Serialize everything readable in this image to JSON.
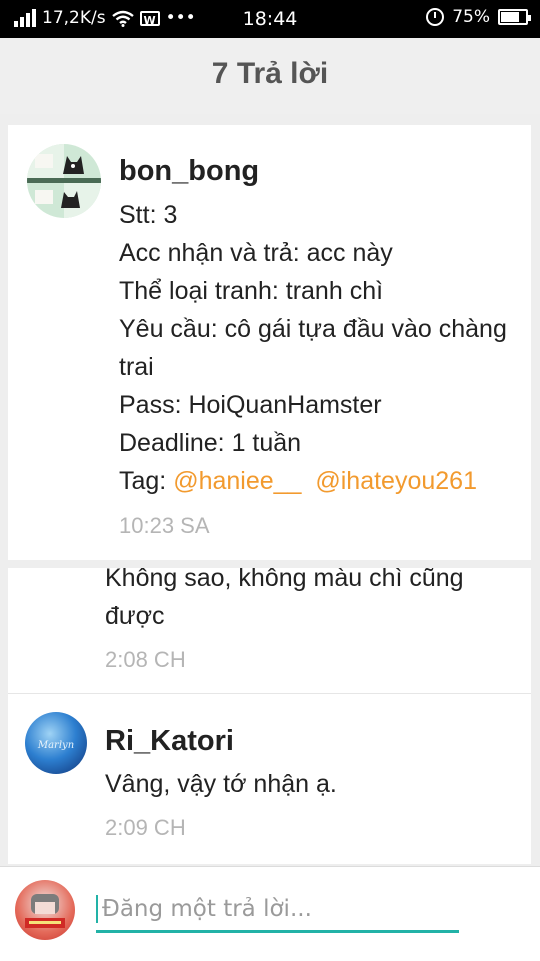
{
  "status_bar": {
    "speed": "17,2K/s",
    "dots": "•••",
    "w_label": "W",
    "time": "18:44",
    "battery": "75%",
    "battery_level": 0.75
  },
  "header": {
    "title": "7 Trả lời"
  },
  "posts": [
    {
      "username": "bon_bong",
      "lines": [
        "Stt: 3",
        "Acc nhận và trả: acc này",
        "Thể loại tranh: tranh chì",
        "Yêu cầu: cô gái tựa đầu vào chàng",
        "trai",
        "Pass: HoiQuanHamster",
        "Deadline: 1 tuần"
      ],
      "tag_prefix": "Tag: ",
      "mentions": [
        "@haniee__",
        "@ihateyou261"
      ],
      "time": "10:23 SA"
    },
    {
      "lines": [
        "Không sao, không màu chì cũng",
        "được"
      ],
      "time": "2:08 CH"
    },
    {
      "username": "Ri_Katori",
      "avatar_text": "Marlyn",
      "lines": [
        "Vâng, vậy tớ nhận ạ."
      ],
      "time": "2:09 CH"
    }
  ],
  "composer": {
    "placeholder": "Đăng một trả lời...",
    "accent": "#22b2a7"
  },
  "colors": {
    "mention": "#f29a2e",
    "timestamp": "#b5b5b5",
    "background": "#eeeeee"
  }
}
